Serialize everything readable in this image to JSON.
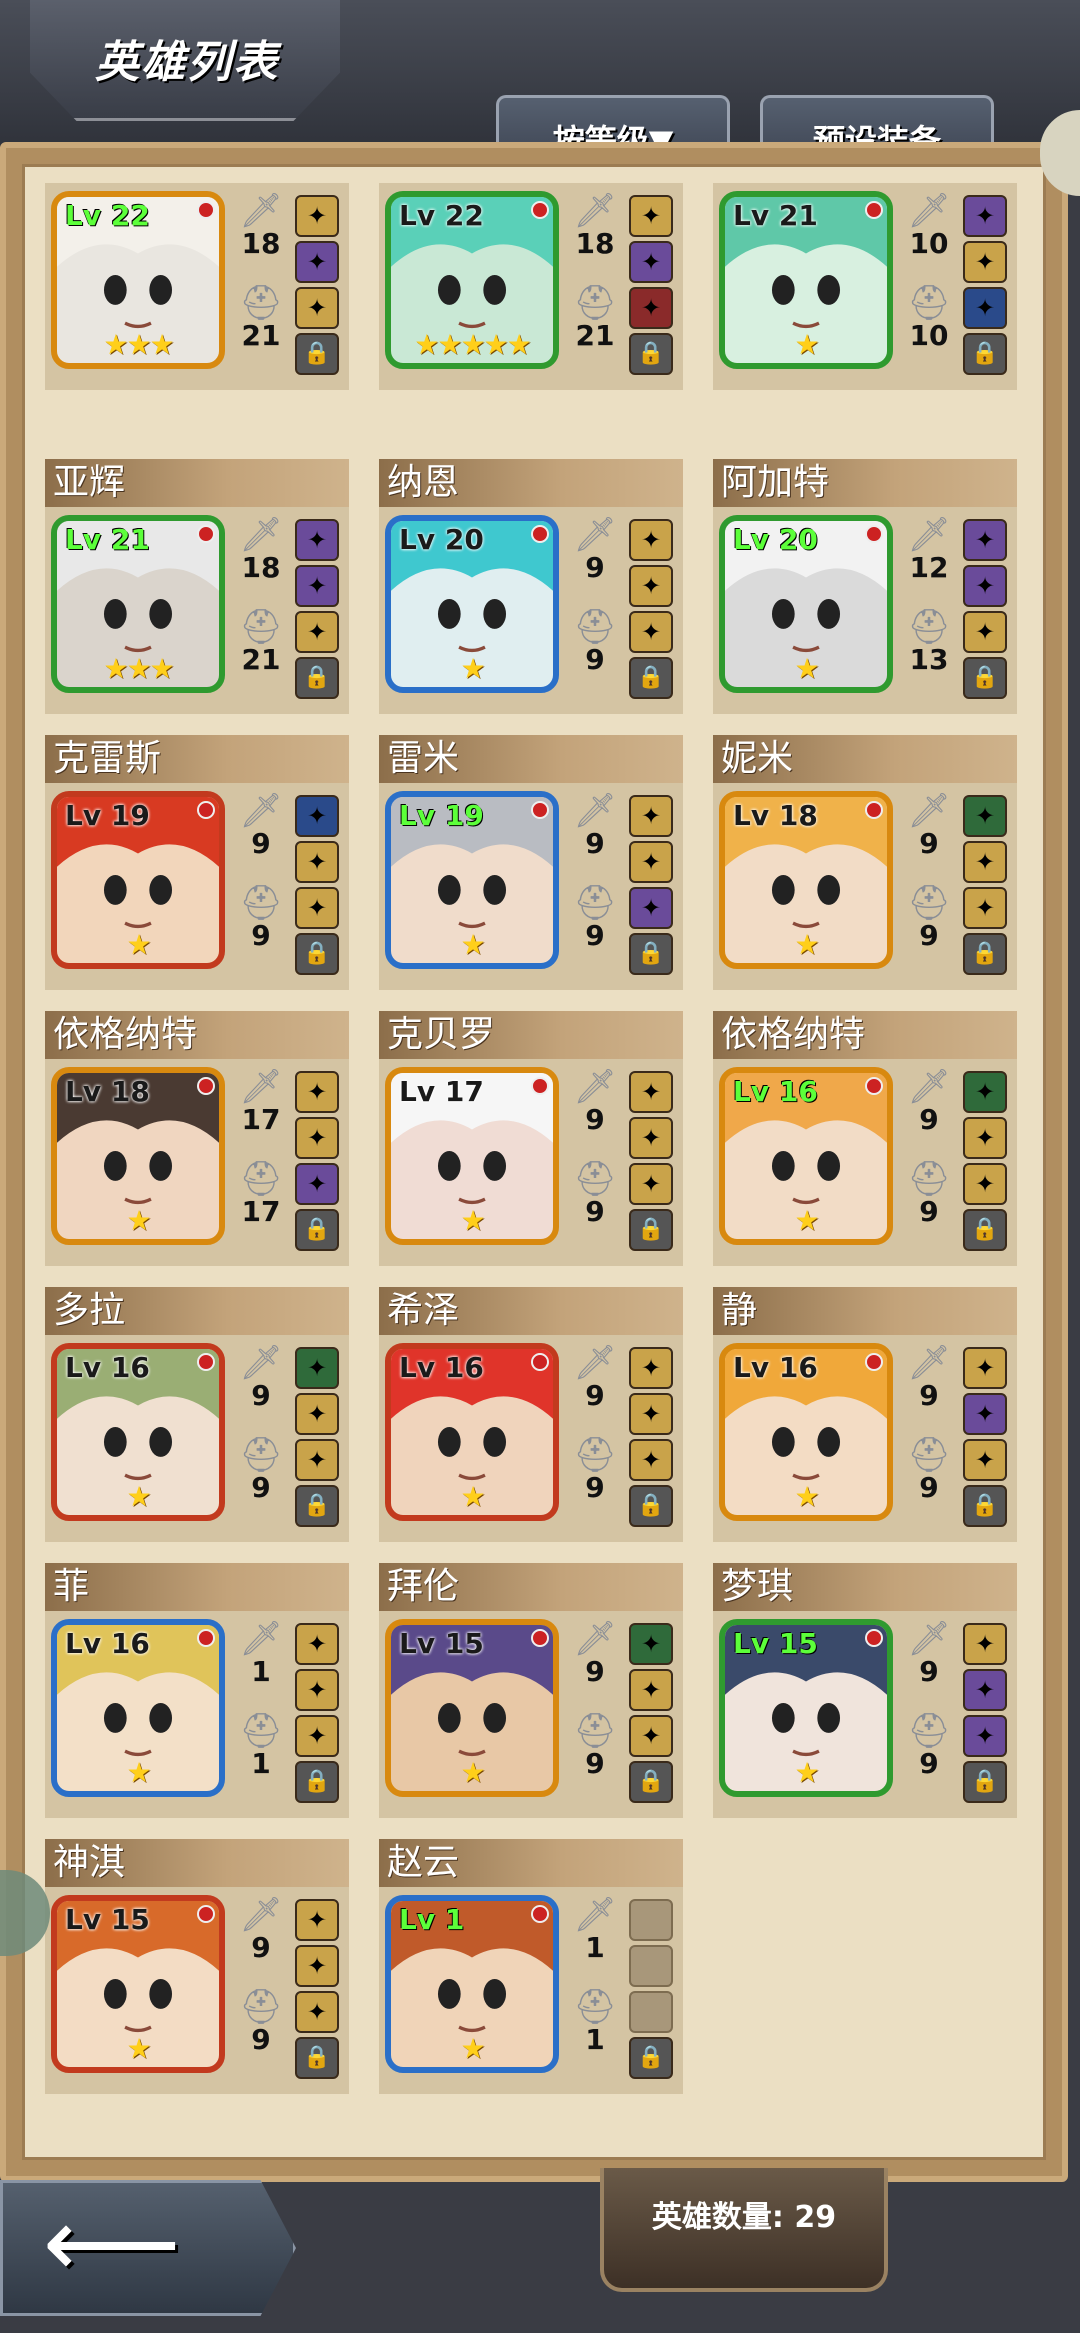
{
  "header": {
    "title": "英雄列表"
  },
  "tabs": {
    "sort_label": "按等级▼",
    "preset_label": "预设装备"
  },
  "footer": {
    "hero_count": "英雄数量: 29"
  },
  "heroes": [
    {
      "name": "",
      "level": "Lv 22",
      "lv_green": true,
      "frame": "#d8890f",
      "stars": "★★★",
      "atk": "18",
      "def": "21",
      "slots": [
        "#c9a34a",
        "#6a4b9a",
        "#c9a34a"
      ],
      "face": "#e9e6e0",
      "hair": "#f3f0ea"
    },
    {
      "name": "",
      "level": "Lv 22",
      "lv_green": false,
      "frame": "#2f9a2f",
      "stars": "★★★★★",
      "atk": "18",
      "def": "21",
      "slots": [
        "#c9a34a",
        "#6a4b9a",
        "#8a2a2a"
      ],
      "face": "#c9e8d5",
      "hair": "#5ad0b8"
    },
    {
      "name": "",
      "level": "Lv 21",
      "lv_green": false,
      "frame": "#2f9a2f",
      "stars": "★",
      "atk": "10",
      "def": "10",
      "slots": [
        "#6a4b9a",
        "#c9a34a",
        "#2a4a8a"
      ],
      "face": "#d8f0e0",
      "hair": "#5fc8a8"
    },
    {
      "name": "亚辉",
      "level": "Lv 21",
      "lv_green": true,
      "frame": "#2f9a2f",
      "stars": "★★★",
      "atk": "18",
      "def": "21",
      "slots": [
        "#6a4b9a",
        "#6a4b9a",
        "#c9a34a"
      ],
      "face": "#dad4cc",
      "hair": "#e8e8e8"
    },
    {
      "name": "纳恩",
      "level": "Lv 20",
      "lv_green": false,
      "frame": "#2a6fc8",
      "stars": "★",
      "atk": "9",
      "def": "9",
      "slots": [
        "#c9a34a",
        "#c9a34a",
        "#c9a34a"
      ],
      "face": "#e0eef0",
      "hair": "#3fc8cf"
    },
    {
      "name": "阿加特",
      "level": "Lv 20",
      "lv_green": true,
      "frame": "#2f9a2f",
      "stars": "★",
      "atk": "12",
      "def": "13",
      "slots": [
        "#6a4b9a",
        "#6a4b9a",
        "#c9a34a"
      ],
      "face": "#dadada",
      "hair": "#f2f2f2"
    },
    {
      "name": "克雷斯",
      "level": "Lv 19",
      "lv_green": false,
      "frame": "#c23a1e",
      "stars": "★",
      "atk": "9",
      "def": "9",
      "slots": [
        "#2a4a8a",
        "#c9a34a",
        "#c9a34a"
      ],
      "face": "#f2d6bb",
      "hair": "#d83a22"
    },
    {
      "name": "雷米",
      "level": "Lv 19",
      "lv_green": true,
      "frame": "#2a6fc8",
      "stars": "★",
      "atk": "9",
      "def": "9",
      "slots": [
        "#c9a34a",
        "#c9a34a",
        "#6a4b9a"
      ],
      "face": "#f0dccb",
      "hair": "#b9bcc2"
    },
    {
      "name": "妮米",
      "level": "Lv 18",
      "lv_green": false,
      "frame": "#d8890f",
      "stars": "★",
      "atk": "9",
      "def": "9",
      "slots": [
        "#2f6a3a",
        "#c9a34a",
        "#c9a34a"
      ],
      "face": "#f2dcc6",
      "hair": "#f0b24a"
    },
    {
      "name": "依格纳特",
      "level": "Lv 18",
      "lv_green": false,
      "frame": "#d8890f",
      "stars": "★",
      "atk": "17",
      "def": "17",
      "slots": [
        "#c9a34a",
        "#c9a34a",
        "#6a4b9a"
      ],
      "face": "#f0d6c0",
      "hair": "#4a3a32"
    },
    {
      "name": "克贝罗",
      "level": "Lv 17",
      "lv_green": false,
      "frame": "#d8890f",
      "stars": "★",
      "atk": "9",
      "def": "9",
      "slots": [
        "#c9a34a",
        "#c9a34a",
        "#c9a34a"
      ],
      "face": "#f0dcd4",
      "hair": "#f6f6f6"
    },
    {
      "name": "依格纳特",
      "level": "Lv 16",
      "lv_green": true,
      "frame": "#d8890f",
      "stars": "★",
      "atk": "9",
      "def": "9",
      "slots": [
        "#2f6a3a",
        "#c9a34a",
        "#c9a34a"
      ],
      "face": "#f2dcc6",
      "hair": "#f0a84a"
    },
    {
      "name": "多拉",
      "level": "Lv 16",
      "lv_green": false,
      "frame": "#c23a1e",
      "stars": "★",
      "atk": "9",
      "def": "9",
      "slots": [
        "#2f6a3a",
        "#c9a34a",
        "#c9a34a"
      ],
      "face": "#f0e0d0",
      "hair": "#9aae74"
    },
    {
      "name": "希泽",
      "level": "Lv 16",
      "lv_green": false,
      "frame": "#c23a1e",
      "stars": "★",
      "atk": "9",
      "def": "9",
      "slots": [
        "#c9a34a",
        "#c9a34a",
        "#c9a34a"
      ],
      "face": "#f0d4bc",
      "hair": "#e0342a"
    },
    {
      "name": "静",
      "level": "Lv 16",
      "lv_green": false,
      "frame": "#d8890f",
      "stars": "★",
      "atk": "9",
      "def": "9",
      "slots": [
        "#c9a34a",
        "#6a4b9a",
        "#c9a34a"
      ],
      "face": "#f3dcc4",
      "hair": "#f0a83a"
    },
    {
      "name": "菲",
      "level": "Lv 16",
      "lv_green": false,
      "frame": "#2a6fc8",
      "stars": "★",
      "atk": "1",
      "def": "1",
      "slots": [
        "#c9a34a",
        "#c9a34a",
        "#c9a34a"
      ],
      "face": "#f3e0c8",
      "hair": "#e0c45a"
    },
    {
      "name": "拜伦",
      "level": "Lv 15",
      "lv_green": false,
      "frame": "#d8890f",
      "stars": "★",
      "atk": "9",
      "def": "9",
      "slots": [
        "#2f6a3a",
        "#c9a34a",
        "#c9a34a"
      ],
      "face": "#e8c8a6",
      "hair": "#5a4a8a"
    },
    {
      "name": "梦琪",
      "level": "Lv 15",
      "lv_green": true,
      "frame": "#2f9a2f",
      "stars": "★",
      "atk": "9",
      "def": "9",
      "slots": [
        "#c9a34a",
        "#6a4b9a",
        "#6a4b9a"
      ],
      "face": "#f0e4dc",
      "hair": "#3a4a6a"
    },
    {
      "name": "神淇",
      "level": "Lv 15",
      "lv_green": false,
      "frame": "#c23a1e",
      "stars": "★",
      "atk": "9",
      "def": "9",
      "slots": [
        "#c9a34a",
        "#c9a34a",
        "#c9a34a"
      ],
      "face": "#f3dcc4",
      "hair": "#d86a2a"
    },
    {
      "name": "赵云",
      "level": "Lv 1",
      "lv_green": true,
      "frame": "#2a6fc8",
      "stars": "★",
      "atk": "1",
      "def": "1",
      "slots": [
        "",
        "",
        ""
      ],
      "face": "#f0d4b8",
      "hair": "#c05a2a"
    }
  ]
}
